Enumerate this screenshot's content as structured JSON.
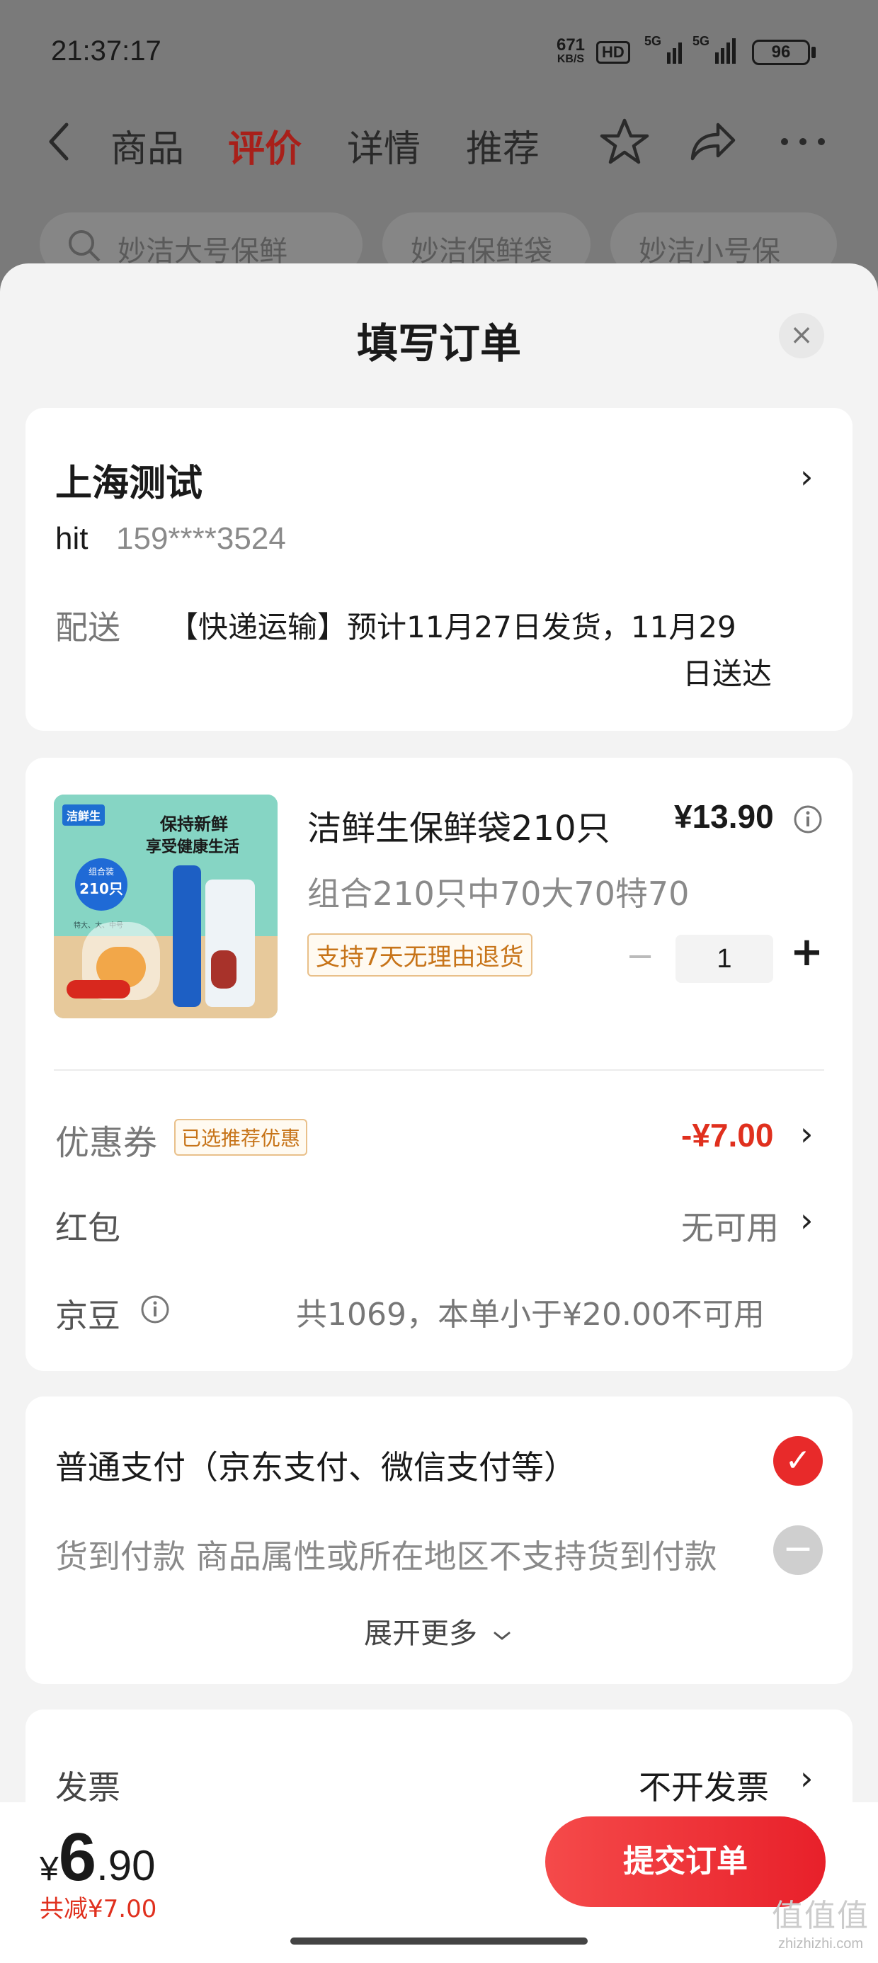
{
  "status_bar": {
    "time": "21:37:17",
    "net_speed": "671",
    "net_unit": "KB/S",
    "hd": "HD",
    "sig1": "5G",
    "sig2": "5G",
    "battery": "96"
  },
  "nav": {
    "tabs": [
      "商品",
      "评价",
      "详情",
      "推荐"
    ],
    "active_index": 1
  },
  "search_chips": [
    "妙洁大号保鲜",
    "妙洁保鲜袋",
    "妙洁小号保"
  ],
  "sheet": {
    "title": "填写订单",
    "close": "×"
  },
  "address": {
    "name": "上海测试",
    "user": "hit",
    "phone": "159****3524",
    "delivery_label": "配送",
    "delivery_line1": "【快递运输】预计11月27日发货，11月29",
    "delivery_line2": "日送达"
  },
  "product": {
    "title": "洁鲜生保鲜袋210只",
    "price": "¥13.90",
    "spec": "组合210只中70大70特70",
    "tag": "支持7天无理由退货",
    "quantity": "1",
    "minus": "−",
    "plus": "+",
    "image": {
      "brand": "洁鲜生",
      "headline1": "保持新鲜",
      "headline2": "享受健康生活",
      "sticker_top": "组合装",
      "sticker_main": "210只",
      "sticker_sub": "特大、大、中号"
    }
  },
  "discounts": {
    "coupon_label": "优惠券",
    "coupon_tag": "已选推荐优惠",
    "coupon_value": "-¥7.00",
    "redpacket_label": "红包",
    "redpacket_value": "无可用",
    "jingdou_label": "京豆",
    "jingdou_value": "共1069，本单小于¥20.00不可用"
  },
  "payment": {
    "option1": "普通支付（京东支付、微信支付等）",
    "option2": "货到付款 商品属性或所在地区不支持货到付款",
    "expand": "展开更多"
  },
  "invoice": {
    "label": "发票",
    "value": "不开发票"
  },
  "footer": {
    "currency": "¥",
    "total_int": "6",
    "total_dec": ".90",
    "saving": "共减¥7.00",
    "submit": "提交订单"
  },
  "watermark": {
    "line1": "值值值",
    "line2": "zhizhizhi.com"
  },
  "colors": {
    "accent_red": "#e8202a",
    "price_red": "#e0301e",
    "tag_orange": "#c77419"
  }
}
